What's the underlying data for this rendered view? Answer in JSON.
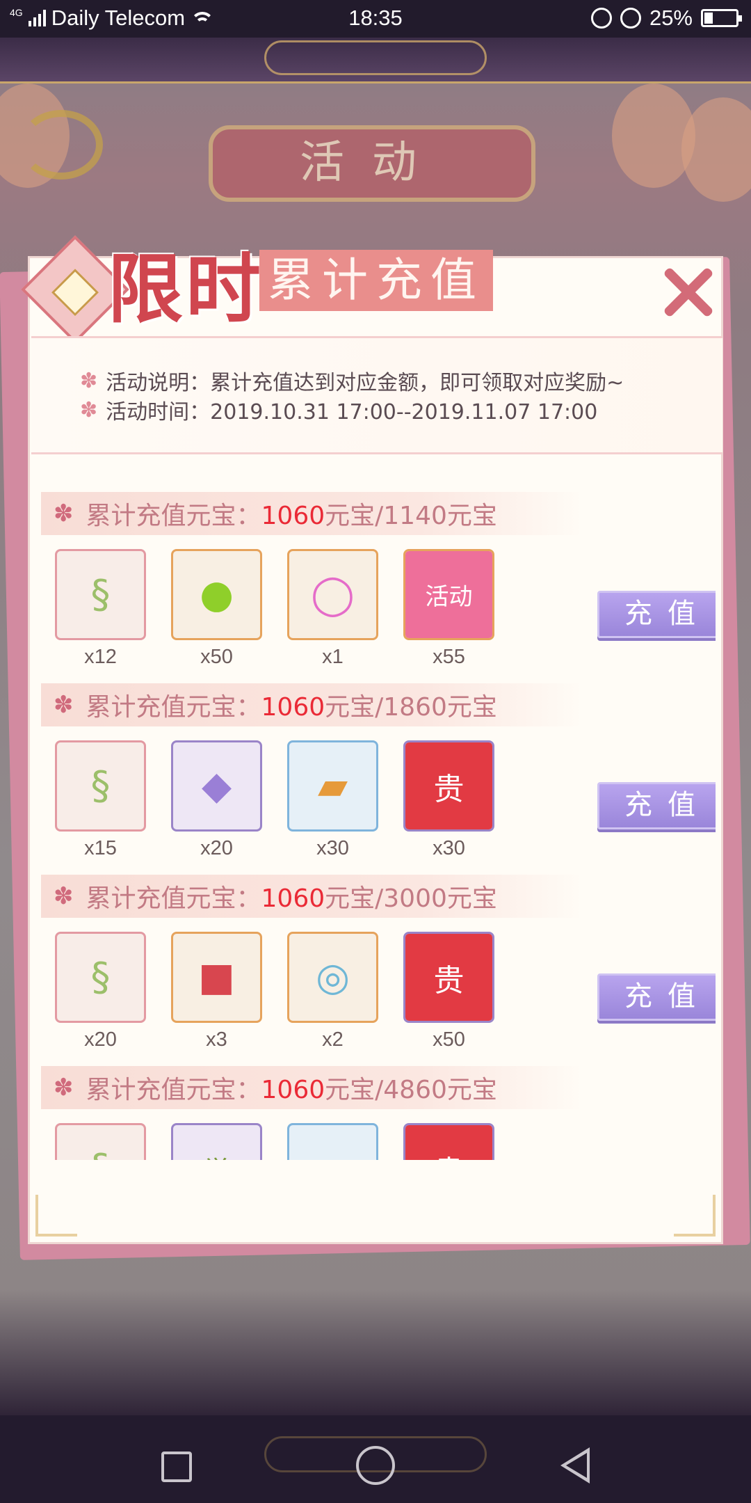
{
  "status_bar": {
    "network": "4G",
    "carrier": "Daily Telecom",
    "time": "18:35",
    "battery": "25%"
  },
  "background": {
    "page_title": "活动"
  },
  "dialog": {
    "title_main": "限时",
    "title_sub": "累计充值",
    "info_lines": [
      "活动说明：累计充值达到对应金额，即可领取对应奖励~",
      "活动时间：2019.10.31 17:00--2019.11.07 17:00"
    ],
    "tiers": [
      {
        "label": "累计充值元宝：",
        "current": "1060",
        "target": "元宝/1140元宝",
        "button": "充值",
        "items": [
          {
            "icon": "jade-pendant-icon",
            "count": "x12",
            "frame": "pink"
          },
          {
            "icon": "green-orb-icon",
            "count": "x50",
            "frame": "gold"
          },
          {
            "icon": "pink-bracelet-icon",
            "count": "x1",
            "frame": "gold"
          },
          {
            "icon": "activity-card-icon",
            "count": "x55",
            "frame": "gold"
          }
        ]
      },
      {
        "label": "累计充值元宝：",
        "current": "1060",
        "target": "元宝/1860元宝",
        "button": "充值",
        "items": [
          {
            "icon": "jade-pendant-icon",
            "count": "x15",
            "frame": "pink"
          },
          {
            "icon": "purple-crystal-icon",
            "count": "x20",
            "frame": "purple"
          },
          {
            "icon": "scroll-book-icon",
            "count": "x30",
            "frame": "blue"
          },
          {
            "icon": "red-envelope-icon",
            "count": "x30",
            "frame": "purple"
          }
        ]
      },
      {
        "label": "累计充值元宝：",
        "current": "1060",
        "target": "元宝/3000元宝",
        "button": "充值",
        "items": [
          {
            "icon": "jade-pendant-icon",
            "count": "x20",
            "frame": "pink"
          },
          {
            "icon": "gift-box-icon",
            "count": "x3",
            "frame": "gold"
          },
          {
            "icon": "jade-ring-icon",
            "count": "x2",
            "frame": "gold"
          },
          {
            "icon": "red-envelope-icon",
            "count": "x50",
            "frame": "purple"
          }
        ]
      },
      {
        "label": "累计充值元宝：",
        "current": "1060",
        "target": "元宝/4860元宝",
        "button": "",
        "items": [
          {
            "icon": "jade-pendant-icon",
            "count": "",
            "frame": "pink"
          },
          {
            "icon": "awaken-pendant-icon",
            "count": "",
            "frame": "purple"
          },
          {
            "icon": "scroll-book-icon",
            "count": "",
            "frame": "blue"
          },
          {
            "icon": "red-envelope-icon",
            "count": "",
            "frame": "purple"
          }
        ]
      }
    ],
    "glyphs": {
      "flower": "✽",
      "red_envelope": "贵",
      "activity_card": "活动",
      "awaken": "觉"
    }
  },
  "colors": {
    "accent_red": "#ea2a36",
    "button_purple": "#a895e2",
    "title_red": "#d0464f"
  }
}
